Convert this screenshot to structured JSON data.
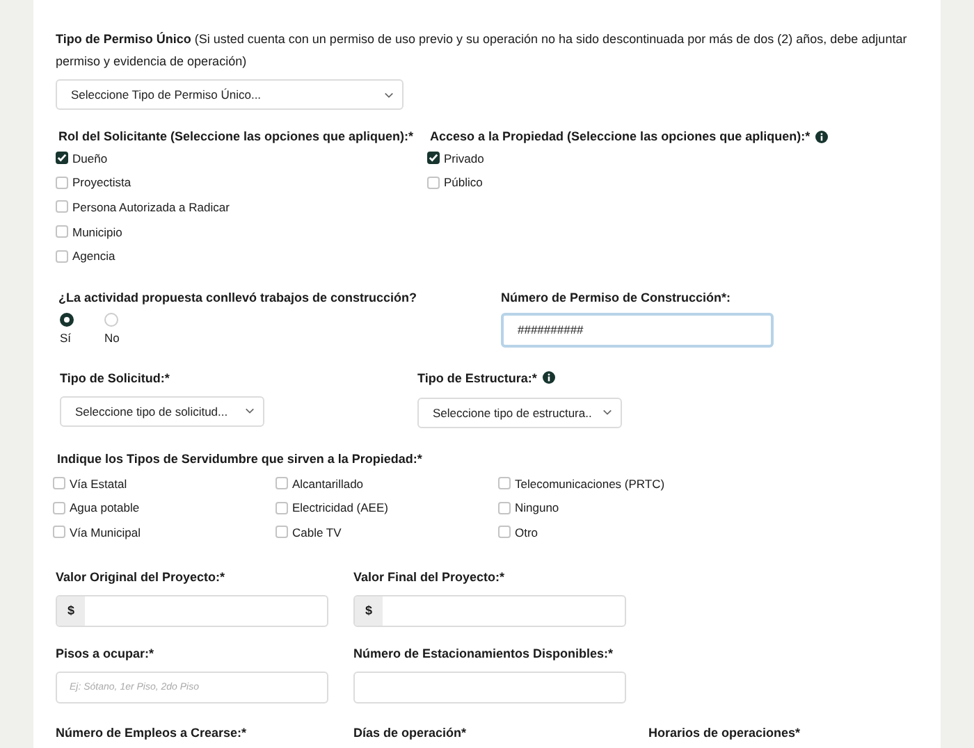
{
  "permit_type": {
    "label": "Tipo de Permiso Único",
    "note": "(Si usted cuenta con un permiso de uso previo y su operación no ha sido descontinuada por más de dos (2) años, debe adjuntar permiso y evidencia de operación)",
    "select": "Seleccione Tipo de Permiso Único..."
  },
  "applicant_role": {
    "label": "Rol del Solicitante (Seleccione las opciones que apliquen):*",
    "options": [
      {
        "label": "Dueño",
        "checked": true
      },
      {
        "label": "Proyectista",
        "checked": false
      },
      {
        "label": "Persona Autorizada a Radicar",
        "checked": false
      },
      {
        "label": "Municipio",
        "checked": false
      },
      {
        "label": "Agencia",
        "checked": false
      }
    ]
  },
  "property_access": {
    "label": "Acceso a la Propiedad (Seleccione las opciones que apliquen):*",
    "info": true,
    "options": [
      {
        "label": "Privado",
        "checked": true
      },
      {
        "label": "Público",
        "checked": false
      }
    ]
  },
  "construction": {
    "label": "¿La actividad propuesta conllevó trabajos de construcción?",
    "options": [
      {
        "label": "Sí",
        "selected": true
      },
      {
        "label": "No",
        "selected": false
      }
    ]
  },
  "construction_permit": {
    "label": "Número de Permiso de Construcción*:",
    "value": "##########",
    "focused": true
  },
  "request_type": {
    "label": "Tipo de Solicitud:*",
    "select": "Seleccione tipo de solicitud..."
  },
  "structure_type": {
    "label": "Tipo de Estructura:*",
    "info": true,
    "select": "Seleccione tipo de estructura.."
  },
  "easements": {
    "label": "Indique los Tipos de Servidumbre que sirven a la Propiedad:*",
    "columns": [
      [
        {
          "label": "Vía Estatal",
          "checked": false
        },
        {
          "label": "Agua potable",
          "checked": false
        },
        {
          "label": "Vía Municipal",
          "checked": false
        }
      ],
      [
        {
          "label": "Alcantarillado",
          "checked": false
        },
        {
          "label": "Electricidad (AEE)",
          "checked": false
        },
        {
          "label": "Cable TV",
          "checked": false
        }
      ],
      [
        {
          "label": "Telecomunicaciones (PRTC)",
          "checked": false
        },
        {
          "label": "Ninguno",
          "checked": false
        },
        {
          "label": "Otro",
          "checked": false
        }
      ]
    ]
  },
  "fields": [
    {
      "label": "Valor Original del Proyecto:*",
      "prefix": "$"
    },
    {
      "label": "Valor Final del Proyecto:*",
      "prefix": "$"
    },
    {
      "label": "Pisos a ocupar:*",
      "placeholder": "Ej: Sótano, 1er Piso, 2do Piso"
    },
    {
      "label": "Número de Estacionamientos Disponibles:*"
    }
  ],
  "bottom_labels": [
    "Número de Empleos a Crearse:*",
    "Días de operación*",
    "Horarios de operaciones*"
  ]
}
